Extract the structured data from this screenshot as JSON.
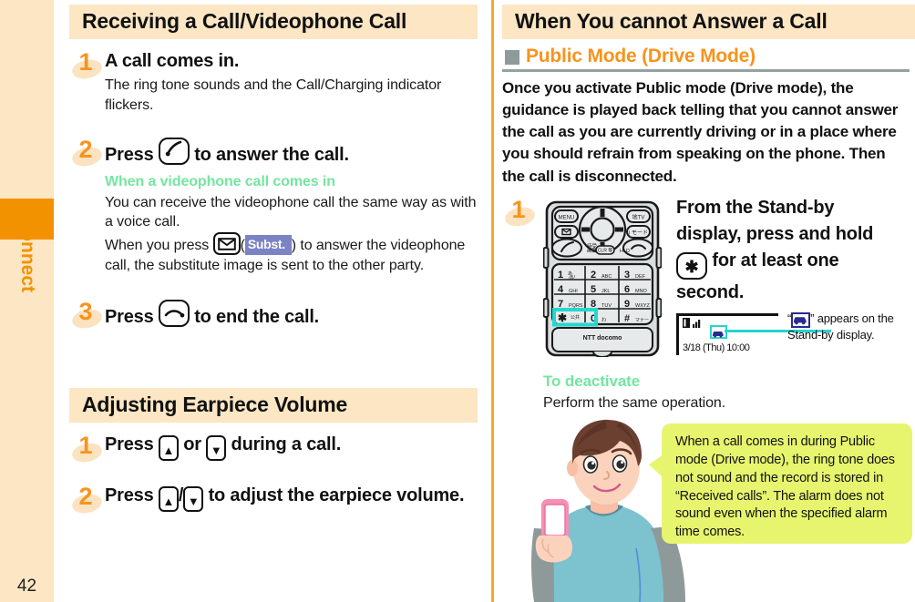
{
  "page": {
    "number": "42",
    "tab_label": "Connect"
  },
  "left_column": {
    "section1": {
      "title": "Receiving a Call/Videophone Call",
      "steps": [
        {
          "num": "1",
          "title": "A call comes in.",
          "body": "The ring tone sounds and the Call/Charging indicator flickers."
        },
        {
          "num": "2",
          "title_before": "Press",
          "title_after": "to answer the call.",
          "key_icon": "call-key-icon",
          "green_head": "When a videophone call comes in",
          "body_line1": "You can receive the videophone call the same way as with a voice call.",
          "body_line2_before": "When you press",
          "mail_key_icon": "mail-key-icon",
          "subst_label": "Subst.",
          "body_line2_after": ") to answer the videophone call, the substitute image is sent to the other party."
        },
        {
          "num": "3",
          "title_before": "Press",
          "title_after": "to end the call.",
          "key_icon": "end-call-key-icon"
        }
      ]
    },
    "section2": {
      "title": "Adjusting Earpiece Volume",
      "steps": [
        {
          "num": "1",
          "title_before": "Press",
          "title_mid": "or",
          "title_after": "during a call.",
          "key_up_icon": "up-key-icon",
          "key_down_icon": "down-key-icon"
        },
        {
          "num": "2",
          "title_before": "Press",
          "title_sep": "/",
          "title_after": "to adjust the earpiece volume.",
          "key_up_icon": "up-key-icon",
          "key_down_icon": "down-key-icon"
        }
      ]
    }
  },
  "right_column": {
    "section_title": "When You cannot Answer a Call",
    "subsection_title": "Public Mode (Drive Mode)",
    "intro": "Once you activate Public mode (Drive mode), the guidance is played back telling that you cannot answer the call as you are currently driving or in a place where you should refrain from speaking on the phone. Then the call is disconnected.",
    "step": {
      "num": "1",
      "title_line1": "From the Stand-by",
      "title_line2": "display, press and hold",
      "title_line3_after": "for at least one",
      "title_line4": "second.",
      "asterisk_key_icon": "asterisk-key-icon"
    },
    "standby_display": {
      "date_time": "3/18 (Thu) 10:00",
      "icon_name": "drive-mode-car-icon"
    },
    "callout": {
      "quote_open": "“",
      "quote_close": "”",
      "text": " appears on the Stand-by display.",
      "icon_name": "drive-mode-car-icon"
    },
    "deactivate": {
      "heading": "To deactivate",
      "body": "Perform the same operation."
    },
    "bubble_note": "When a call comes in during Public mode (Drive mode), the ring tone does not sound and the record is stored in “Received calls”. The alarm does not sound even when the specified alarm time comes.",
    "phone_illustration": {
      "brand": "docomo",
      "brand_prefix": "NTT",
      "soft_keys": [
        "MENU",
        "✉",
        "☎",
        "地TV",
        "iモード"
      ],
      "keypad": [
        [
          "1",
          "2",
          "3"
        ],
        [
          "4",
          "5",
          "6"
        ],
        [
          "7",
          "8",
          "9"
        ],
        [
          "✳",
          "0",
          "#"
        ]
      ],
      "highlighted_key": "✳"
    }
  },
  "colors": {
    "header_bar": "#fce6c4",
    "accent_orange": "#f7941d",
    "tab_orange": "#f39200",
    "green_head": "#73e6a0",
    "bubble_yellow": "#e7f56e",
    "cyan_highlight": "#25d6cf",
    "chip_purple": "#7b83c4",
    "rule_gray": "#93a1a1"
  }
}
